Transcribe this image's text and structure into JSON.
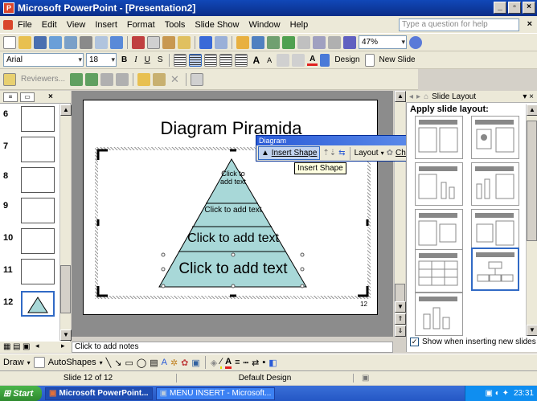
{
  "window": {
    "title": "Microsoft PowerPoint - [Presentation2]",
    "app_icon": "powerpoint-icon"
  },
  "menu": [
    "File",
    "Edit",
    "View",
    "Insert",
    "Format",
    "Tools",
    "Slide Show",
    "Window",
    "Help"
  ],
  "help_box": {
    "placeholder": "Type a question for help"
  },
  "standard_toolbar": {
    "zoom": "47%"
  },
  "formatting_toolbar": {
    "font": "Arial",
    "size": "18",
    "design_label": "Design",
    "new_slide_label": "New Slide"
  },
  "reviewing_toolbar": {
    "reviewers_label": "Reviewers..."
  },
  "thumbnails": [
    {
      "num": "6"
    },
    {
      "num": "7"
    },
    {
      "num": "8"
    },
    {
      "num": "9"
    },
    {
      "num": "10"
    },
    {
      "num": "11"
    },
    {
      "num": "12"
    }
  ],
  "slide": {
    "title": "Diagram Piramida",
    "layers": [
      "Click to add text",
      "Click to add text",
      "Click to add text",
      "Click to add text"
    ],
    "page_number": "12"
  },
  "diagram_toolbar": {
    "title": "Diagram",
    "insert_shape": "Insert Shape",
    "layout": "Layout",
    "change_to": "Change to",
    "tooltip": "Insert Shape"
  },
  "task_pane": {
    "title": "Slide Layout",
    "section_label": "Apply slide layout:",
    "show_check": "Show when inserting new slides"
  },
  "notes": {
    "text": "Click to add notes"
  },
  "draw_toolbar": {
    "draw": "Draw",
    "autoshapes": "AutoShapes"
  },
  "status": {
    "slide": "Slide 12 of 12",
    "design": "Default Design"
  },
  "taskbar": {
    "start": "Start",
    "items": [
      "Microsoft PowerPoint...",
      "MENU INSERT - Microsoft..."
    ],
    "clock": "23:31"
  },
  "colors": {
    "accent": "#316ac5",
    "pyramid": "#a8d8d8",
    "titlebar": "#0a2d88"
  }
}
